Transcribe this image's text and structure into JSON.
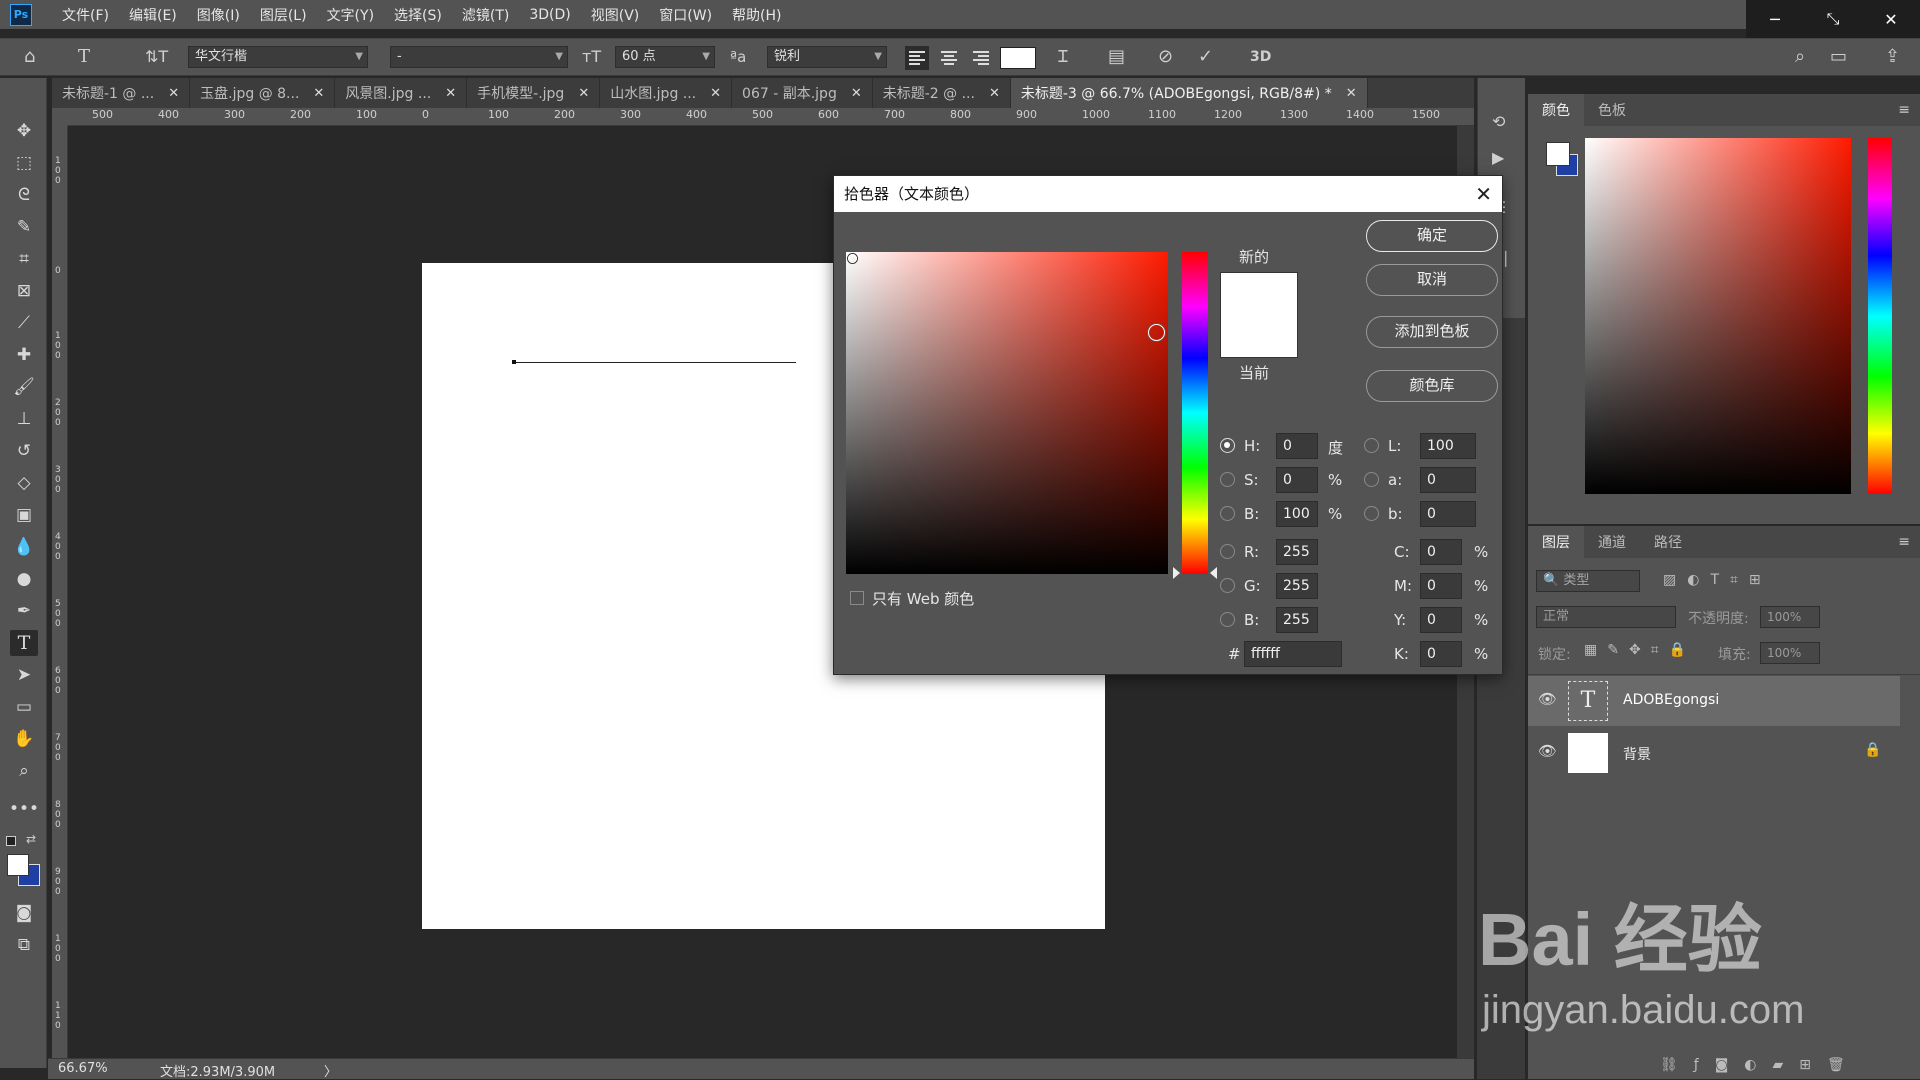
{
  "app": {
    "logo": "Ps"
  },
  "menu": [
    "文件(F)",
    "编辑(E)",
    "图像(I)",
    "图层(L)",
    "文字(Y)",
    "选择(S)",
    "滤镜(T)",
    "3D(D)",
    "视图(V)",
    "窗口(W)",
    "帮助(H)"
  ],
  "window_controls": {
    "minimize": "─",
    "restore": "⤡",
    "close": "✕"
  },
  "options": {
    "font_family": "华文行楷",
    "font_style": "-",
    "font_size": "60 点",
    "aa_label": "ªa",
    "antialias": "锐利",
    "text_color_swatch": "#ffffff"
  },
  "tabs": [
    {
      "label": "未标题-1 @ ...",
      "close": "✕"
    },
    {
      "label": "玉盘.jpg @ 8...",
      "close": "✕"
    },
    {
      "label": "风景图.jpg ...",
      "close": "✕"
    },
    {
      "label": "手机模型-.jpg",
      "close": "✕"
    },
    {
      "label": "山水图.jpg ...",
      "close": "✕"
    },
    {
      "label": "067 - 副本.jpg",
      "close": "✕"
    },
    {
      "label": "未标题-2 @ ...",
      "close": "✕"
    },
    {
      "label": "未标题-3 @ 66.7% (ADOBEgongsi, RGB/8#) *",
      "close": "✕",
      "active": true
    }
  ],
  "ruler": {
    "h": [
      "500",
      "400",
      "300",
      "200",
      "100",
      "0",
      "100",
      "200",
      "300",
      "400",
      "500",
      "600",
      "700",
      "800",
      "900",
      "1000",
      "1100",
      "1200",
      "1300",
      "1400",
      "1500"
    ],
    "v": [
      "1 0 0",
      "0",
      "1 0 0",
      "2 0 0",
      "3 0 0",
      "4 0 0",
      "5 0 0",
      "6 0 0",
      "7 0 0",
      "8 0 0",
      "9 0 0",
      "1 0 0",
      "1 1 0"
    ]
  },
  "status": {
    "zoom": "66.67%",
    "doc": "文档:2.93M/3.90M",
    "arrow": "〉"
  },
  "dialog": {
    "title": "拾色器（文本颜色）",
    "close": "✕",
    "new_label": "新的",
    "current_label": "当前",
    "buttons": {
      "ok": "确定",
      "cancel": "取消",
      "add": "添加到色板",
      "library": "颜色库"
    },
    "web_only": "只有 Web 颜色",
    "hsb": [
      {
        "key": "H:",
        "value": "0",
        "unit": "度",
        "selected": true
      },
      {
        "key": "S:",
        "value": "0",
        "unit": "%"
      },
      {
        "key": "B:",
        "value": "100",
        "unit": "%"
      }
    ],
    "lab": [
      {
        "key": "L:",
        "value": "100"
      },
      {
        "key": "a:",
        "value": "0"
      },
      {
        "key": "b:",
        "value": "0"
      }
    ],
    "rgb": [
      {
        "key": "R:",
        "value": "255"
      },
      {
        "key": "G:",
        "value": "255"
      },
      {
        "key": "B:",
        "value": "255"
      }
    ],
    "cmyk": [
      {
        "key": "C:",
        "value": "0",
        "unit": "%"
      },
      {
        "key": "M:",
        "value": "0",
        "unit": "%"
      },
      {
        "key": "Y:",
        "value": "0",
        "unit": "%"
      },
      {
        "key": "K:",
        "value": "0",
        "unit": "%"
      }
    ],
    "hex_label": "#",
    "hex": "ffffff"
  },
  "color_panel": {
    "tabs": [
      "颜色",
      "色板"
    ]
  },
  "layers_panel": {
    "tabs": [
      "图层",
      "通道",
      "路径"
    ],
    "filter": "🔍 类型",
    "blend": "正常",
    "opacity_label": "不透明度:",
    "opacity": "100%",
    "lock_label": "锁定:",
    "fill_label": "填充:",
    "fill": "100%",
    "layers": [
      {
        "name": "ADOBEgongsi",
        "thumb": "T",
        "selected": true
      },
      {
        "name": "背景",
        "thumb": "",
        "locked": true
      }
    ]
  },
  "watermark": {
    "brand": "Bai 经验",
    "url": "jingyan.baidu.com"
  }
}
